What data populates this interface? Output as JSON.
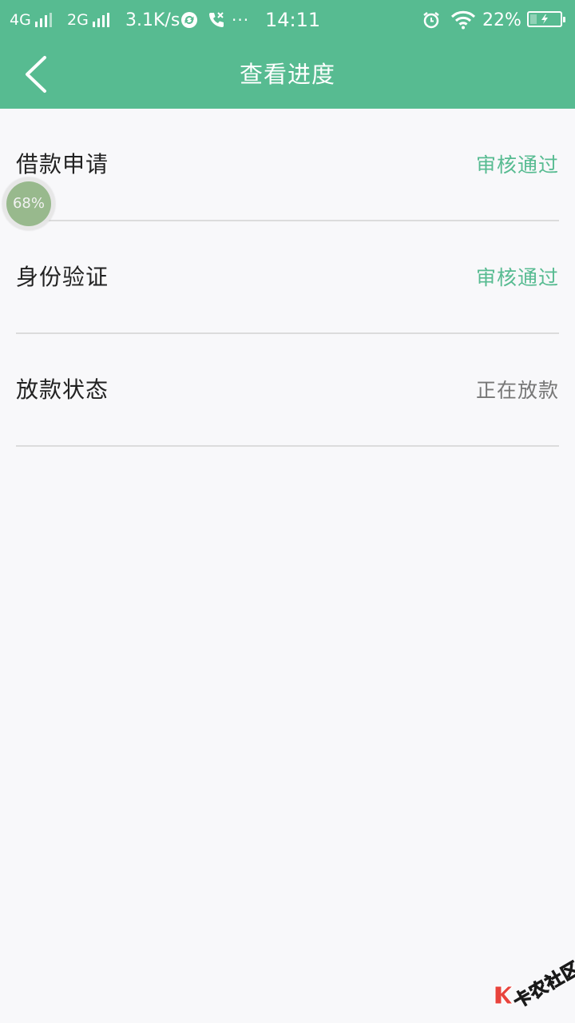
{
  "status_bar": {
    "network1": "4G",
    "network2": "2G",
    "speed": "3.1K/s",
    "more": "···",
    "time": "14:11",
    "battery_percent": "22%",
    "battery_level": 0.22
  },
  "header": {
    "title": "查看进度"
  },
  "rows": [
    {
      "label": "借款申请",
      "status": "审核通过",
      "status_color": "#57bb91"
    },
    {
      "label": "身份验证",
      "status": "审核通过",
      "status_color": "#57bb91"
    },
    {
      "label": "放款状态",
      "status": "正在放款",
      "status_color": "#777777"
    }
  ],
  "float_widget": {
    "text": "68%"
  },
  "watermark": {
    "text": "卡农社区"
  }
}
